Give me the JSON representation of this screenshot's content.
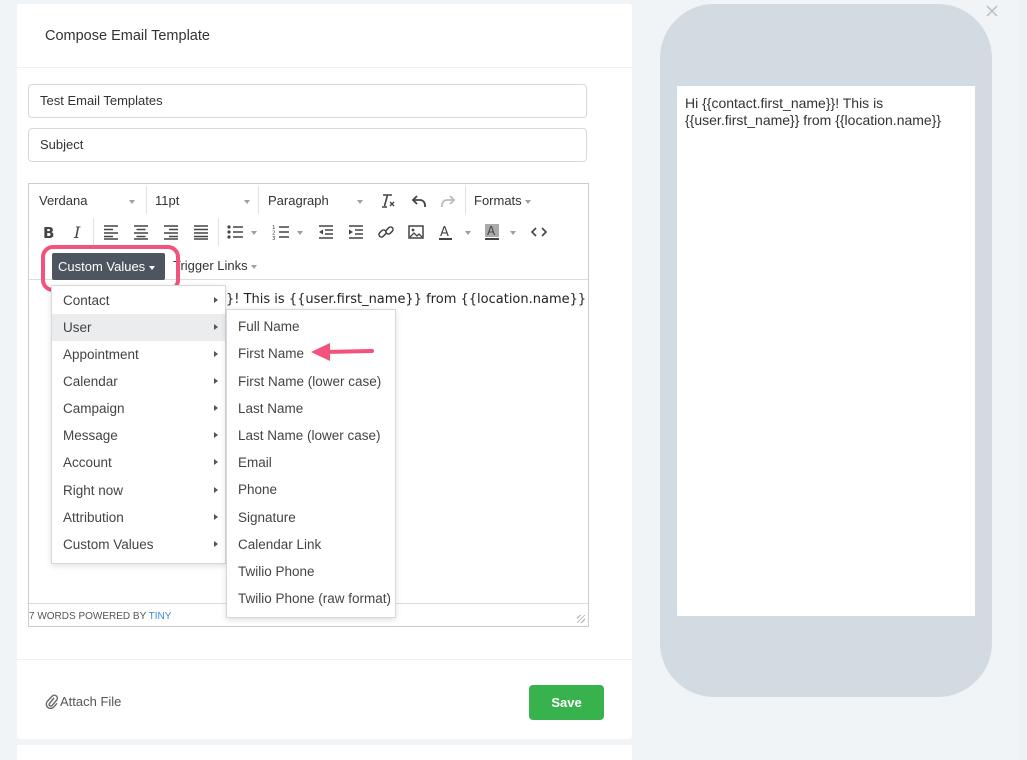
{
  "card": {
    "title": "Compose Email Template",
    "template_name_value": "Test Email Templates",
    "subject_value": "Subject"
  },
  "toolbar": {
    "font_family": "Verdana",
    "font_size": "11pt",
    "block_format": "Paragraph",
    "formats_label": "Formats",
    "custom_values_label": "Custom Values",
    "trigger_links_label": "Trigger Links"
  },
  "editor": {
    "visible_text": "}! This is {{user.first_name}} from {{location.name}}",
    "status_words": "7 WORDS POWERED BY ",
    "status_brand": "TINY"
  },
  "custom_values_menu": {
    "items": [
      {
        "label": "Contact"
      },
      {
        "label": "User",
        "active": true
      },
      {
        "label": "Appointment"
      },
      {
        "label": "Calendar"
      },
      {
        "label": "Campaign"
      },
      {
        "label": "Message"
      },
      {
        "label": "Account"
      },
      {
        "label": "Right now"
      },
      {
        "label": "Attribution"
      },
      {
        "label": "Custom Values"
      }
    ]
  },
  "user_submenu": {
    "items": [
      {
        "label": "Full Name"
      },
      {
        "label": "First Name"
      },
      {
        "label": "First Name (lower case)"
      },
      {
        "label": "Last Name"
      },
      {
        "label": "Last Name (lower case)"
      },
      {
        "label": "Email"
      },
      {
        "label": "Phone"
      },
      {
        "label": "Signature"
      },
      {
        "label": "Calendar Link"
      },
      {
        "label": "Twilio Phone"
      },
      {
        "label": "Twilio Phone (raw format)"
      }
    ]
  },
  "footer": {
    "attach_label": "Attach File",
    "save_label": "Save"
  },
  "preview": {
    "text": "Hi  {{contact.first_name}}! This is {{user.first_name}} from {{location.name}}"
  },
  "colors": {
    "save_green": "#37b24d",
    "highlight_pink": "#f2527c",
    "custom_values_button": "#4c5560",
    "phone_frame": "#d3dbe2",
    "tiny_link": "#3b8bd6"
  },
  "icons": {
    "close": "close-icon",
    "attach": "paperclip-icon",
    "annotation": "pink-arrow-icon"
  }
}
